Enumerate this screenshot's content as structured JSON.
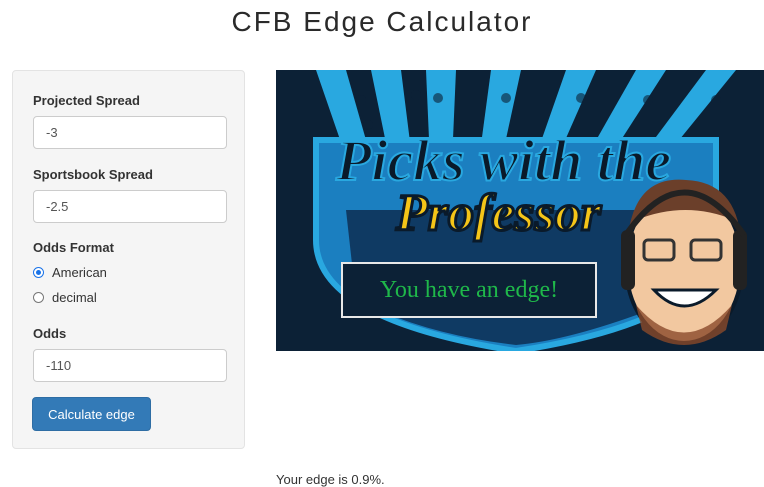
{
  "page": {
    "title": "CFB Edge Calculator"
  },
  "form": {
    "projected_spread_label": "Projected Spread",
    "projected_spread_value": "-3",
    "sportsbook_spread_label": "Sportsbook Spread",
    "sportsbook_spread_value": "-2.5",
    "odds_format_label": "Odds Format",
    "odds_format_options": [
      {
        "label": "American",
        "selected": true
      },
      {
        "label": "decimal",
        "selected": false
      }
    ],
    "odds_label": "Odds",
    "odds_value": "-110",
    "calculate_button": "Calculate edge"
  },
  "banner": {
    "line1": "Picks with the",
    "line2": "Professor",
    "edge_message": "You have an edge!",
    "colors": {
      "navy": "#0c2136",
      "cyan": "#29a8e0",
      "yellow": "#f5c518",
      "green": "#1fb84a"
    }
  },
  "result": {
    "text": "Your edge is 0.9%."
  }
}
